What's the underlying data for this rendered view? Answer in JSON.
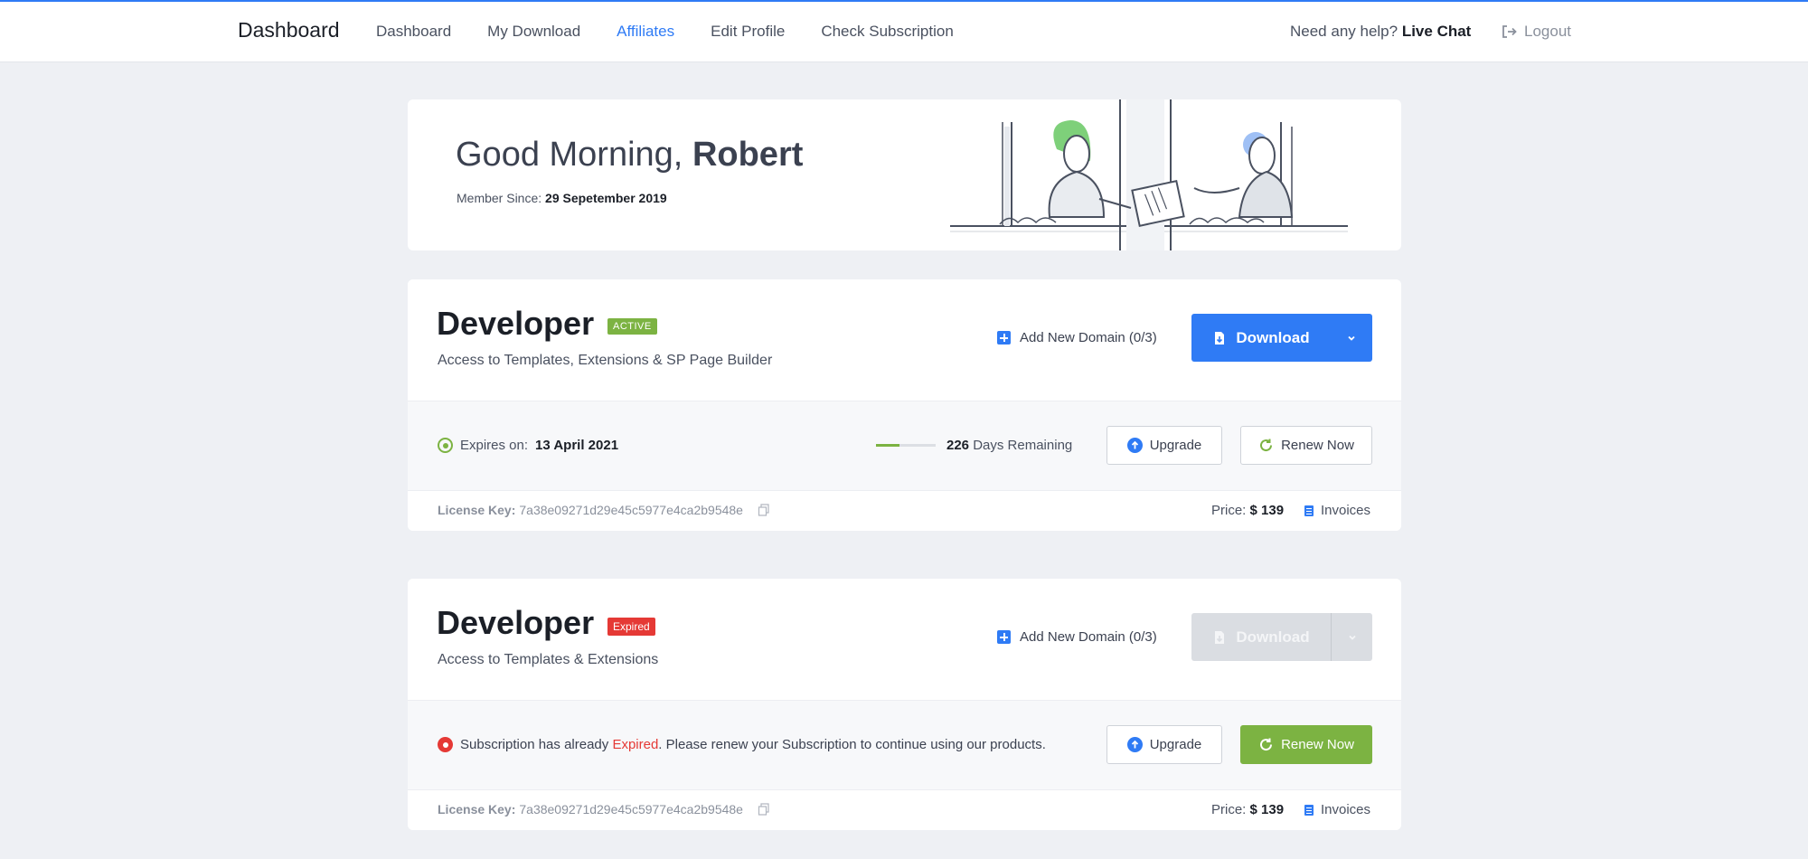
{
  "nav": {
    "brand": "Dashboard",
    "links": [
      "Dashboard",
      "My Download",
      "Affiliates",
      "Edit Profile",
      "Check Subscription"
    ],
    "active": "Affiliates",
    "help_prefix": "Need any help?",
    "help_link": "Live Chat",
    "logout": "Logout"
  },
  "welcome": {
    "greeting": "Good Morning,",
    "name": "Robert",
    "member_since_label": "Member Since:",
    "member_since": "29 Sepetember 2019"
  },
  "plans": [
    {
      "title": "Developer",
      "status": "ACTIVE",
      "description": "Access to Templates, Extensions & SP Page Builder",
      "add_domain": "Add New Domain (0/3)",
      "download_label": "Download",
      "expires_label": "Expires on:",
      "expires_date": "13 April 2021",
      "days_remaining": "226",
      "days_label": "Days Remaining",
      "days_progress": 0.4,
      "upgrade_label": "Upgrade",
      "renew_label": "Renew Now",
      "license_label": "License Key:",
      "license_key": "7a38e09271d29e45c5977e4ca2b9548e",
      "price_label": "Price:",
      "price": "$ 139",
      "invoices": "Invoices"
    },
    {
      "title": "Developer",
      "status": "Expired",
      "description": "Access to Templates & Extensions",
      "add_domain": "Add New Domain (0/3)",
      "download_label": "Download",
      "msg_before": "Subscription has already",
      "msg_expired": "Expired",
      "msg_after": ". Please renew your Subscription to continue using our products.",
      "upgrade_label": "Upgrade",
      "renew_label": "Renew Now",
      "license_label": "License Key:",
      "license_key": "7a38e09271d29e45c5977e4ca2b9548e",
      "price_label": "Price:",
      "price": "$ 139",
      "invoices": "Invoices"
    }
  ],
  "colors": {
    "accent": "#2f7bf5",
    "success": "#7cb342",
    "danger": "#e53935"
  }
}
